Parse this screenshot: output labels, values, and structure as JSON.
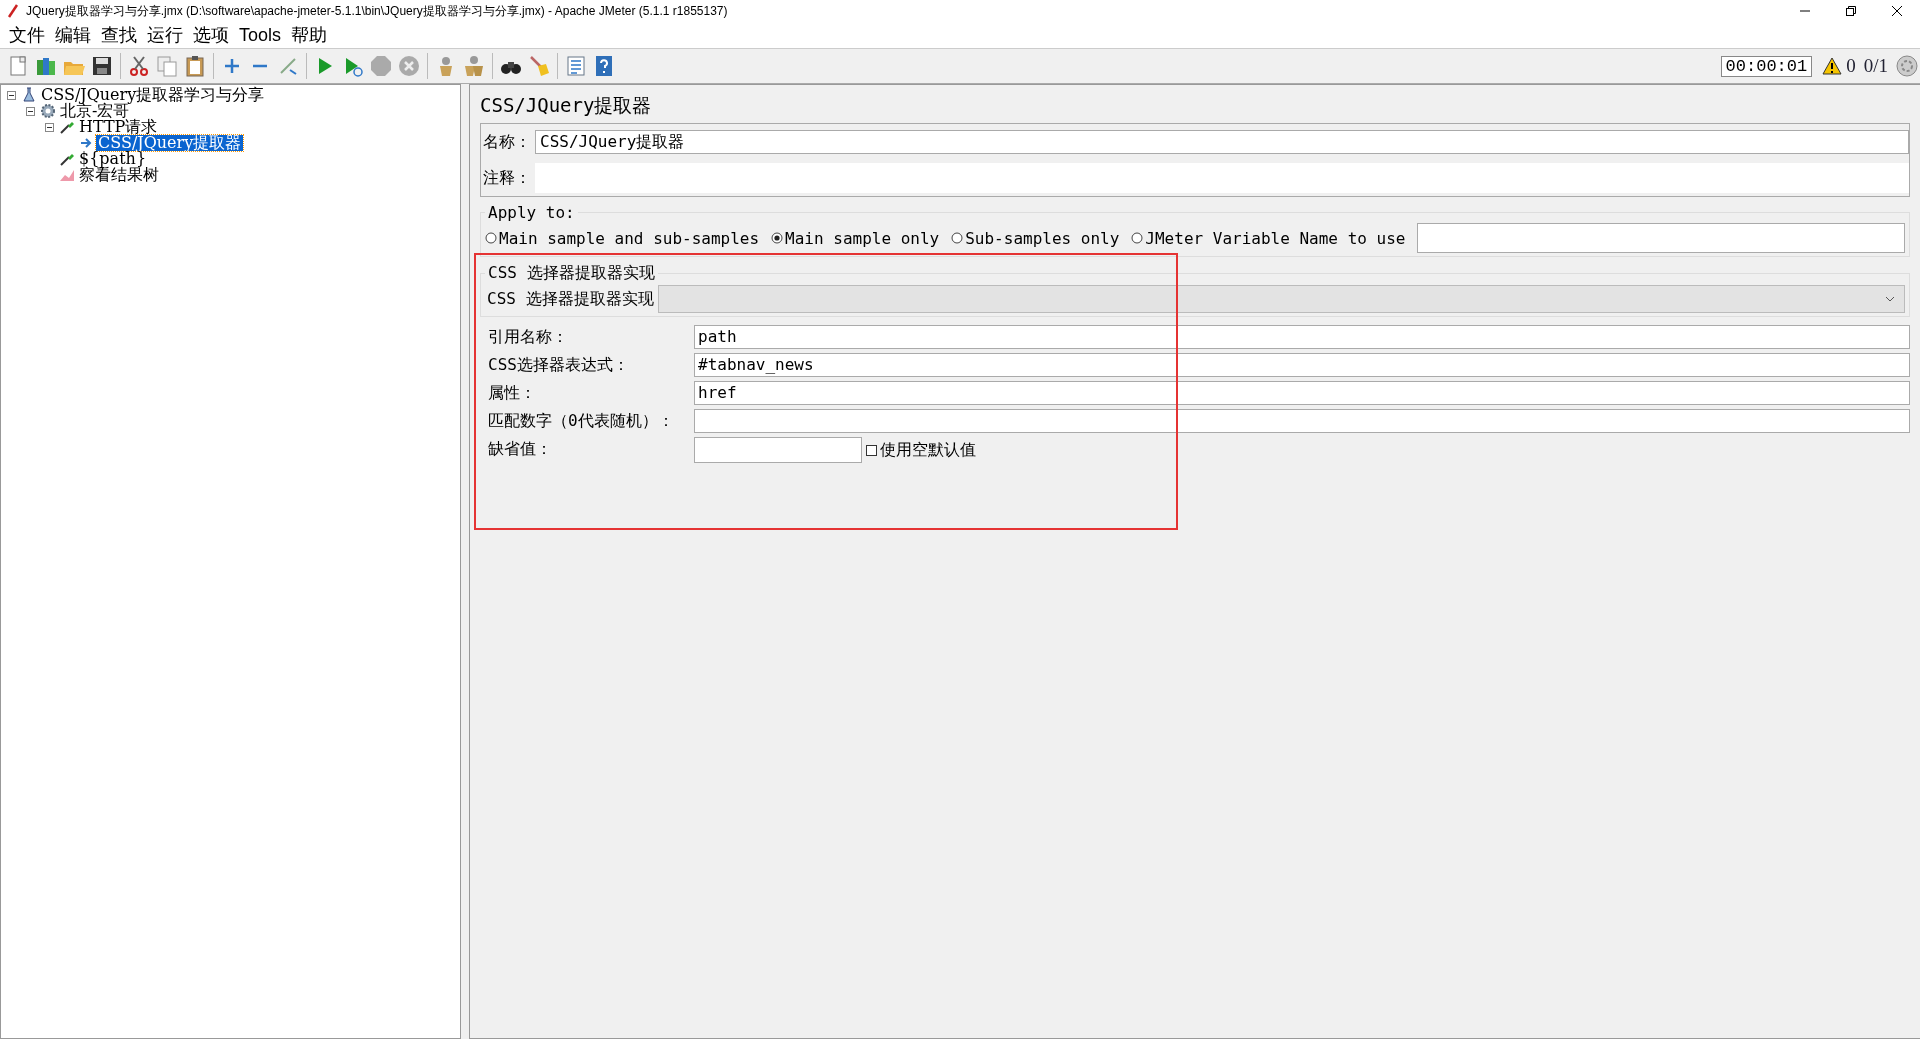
{
  "window": {
    "title": "JQuery提取器学习与分享.jmx (D:\\software\\apache-jmeter-5.1.1\\bin\\JQuery提取器学习与分享.jmx) - Apache JMeter (5.1.1 r1855137)"
  },
  "menu": [
    {
      "label": "文件"
    },
    {
      "label": "编辑"
    },
    {
      "label": "查找"
    },
    {
      "label": "运行"
    },
    {
      "label": "选项"
    },
    {
      "label": "Tools"
    },
    {
      "label": "帮助"
    }
  ],
  "status": {
    "timer": "00:00:01",
    "warnings": "0",
    "threads": "0/1"
  },
  "tree": [
    {
      "label": "CSS/JQuery提取器学习与分享",
      "kind": "plan",
      "expanded": true,
      "selected": false,
      "children": [
        {
          "label": "北京-宏哥",
          "kind": "thread-group",
          "expanded": true,
          "selected": false,
          "children": [
            {
              "label": "HTTP请求",
              "kind": "sampler",
              "expanded": true,
              "selected": false,
              "children": [
                {
                  "label": "CSS/JQuery提取器",
                  "kind": "extractor",
                  "selected": true
                }
              ]
            },
            {
              "label": "${path}",
              "kind": "sampler",
              "selected": false
            },
            {
              "label": "察看结果树",
              "kind": "listener",
              "selected": false
            }
          ]
        }
      ]
    }
  ],
  "form": {
    "title": "CSS/JQuery提取器",
    "name_label": "名称：",
    "name_value": "CSS/JQuery提取器",
    "comment_label": "注释：",
    "apply_to": {
      "legend": "Apply to:",
      "options": [
        {
          "label": "Main sample and sub-samples",
          "selected": false
        },
        {
          "label": "Main sample only",
          "selected": true
        },
        {
          "label": "Sub-samples only",
          "selected": false
        },
        {
          "label": "JMeter Variable Name to use",
          "selected": false
        }
      ]
    },
    "impl": {
      "legend": "CSS 选择器提取器实现",
      "label": "CSS 选择器提取器实现"
    },
    "fields": [
      {
        "label": "引用名称：",
        "value": "path"
      },
      {
        "label": "CSS选择器表达式：",
        "value": "#tabnav_news"
      },
      {
        "label": "属性：",
        "value": "href"
      },
      {
        "label": "匹配数字（0代表随机）："
      }
    ],
    "default": {
      "label": "缺省值：",
      "checkbox_label": "使用空默认值",
      "checked": false
    }
  }
}
